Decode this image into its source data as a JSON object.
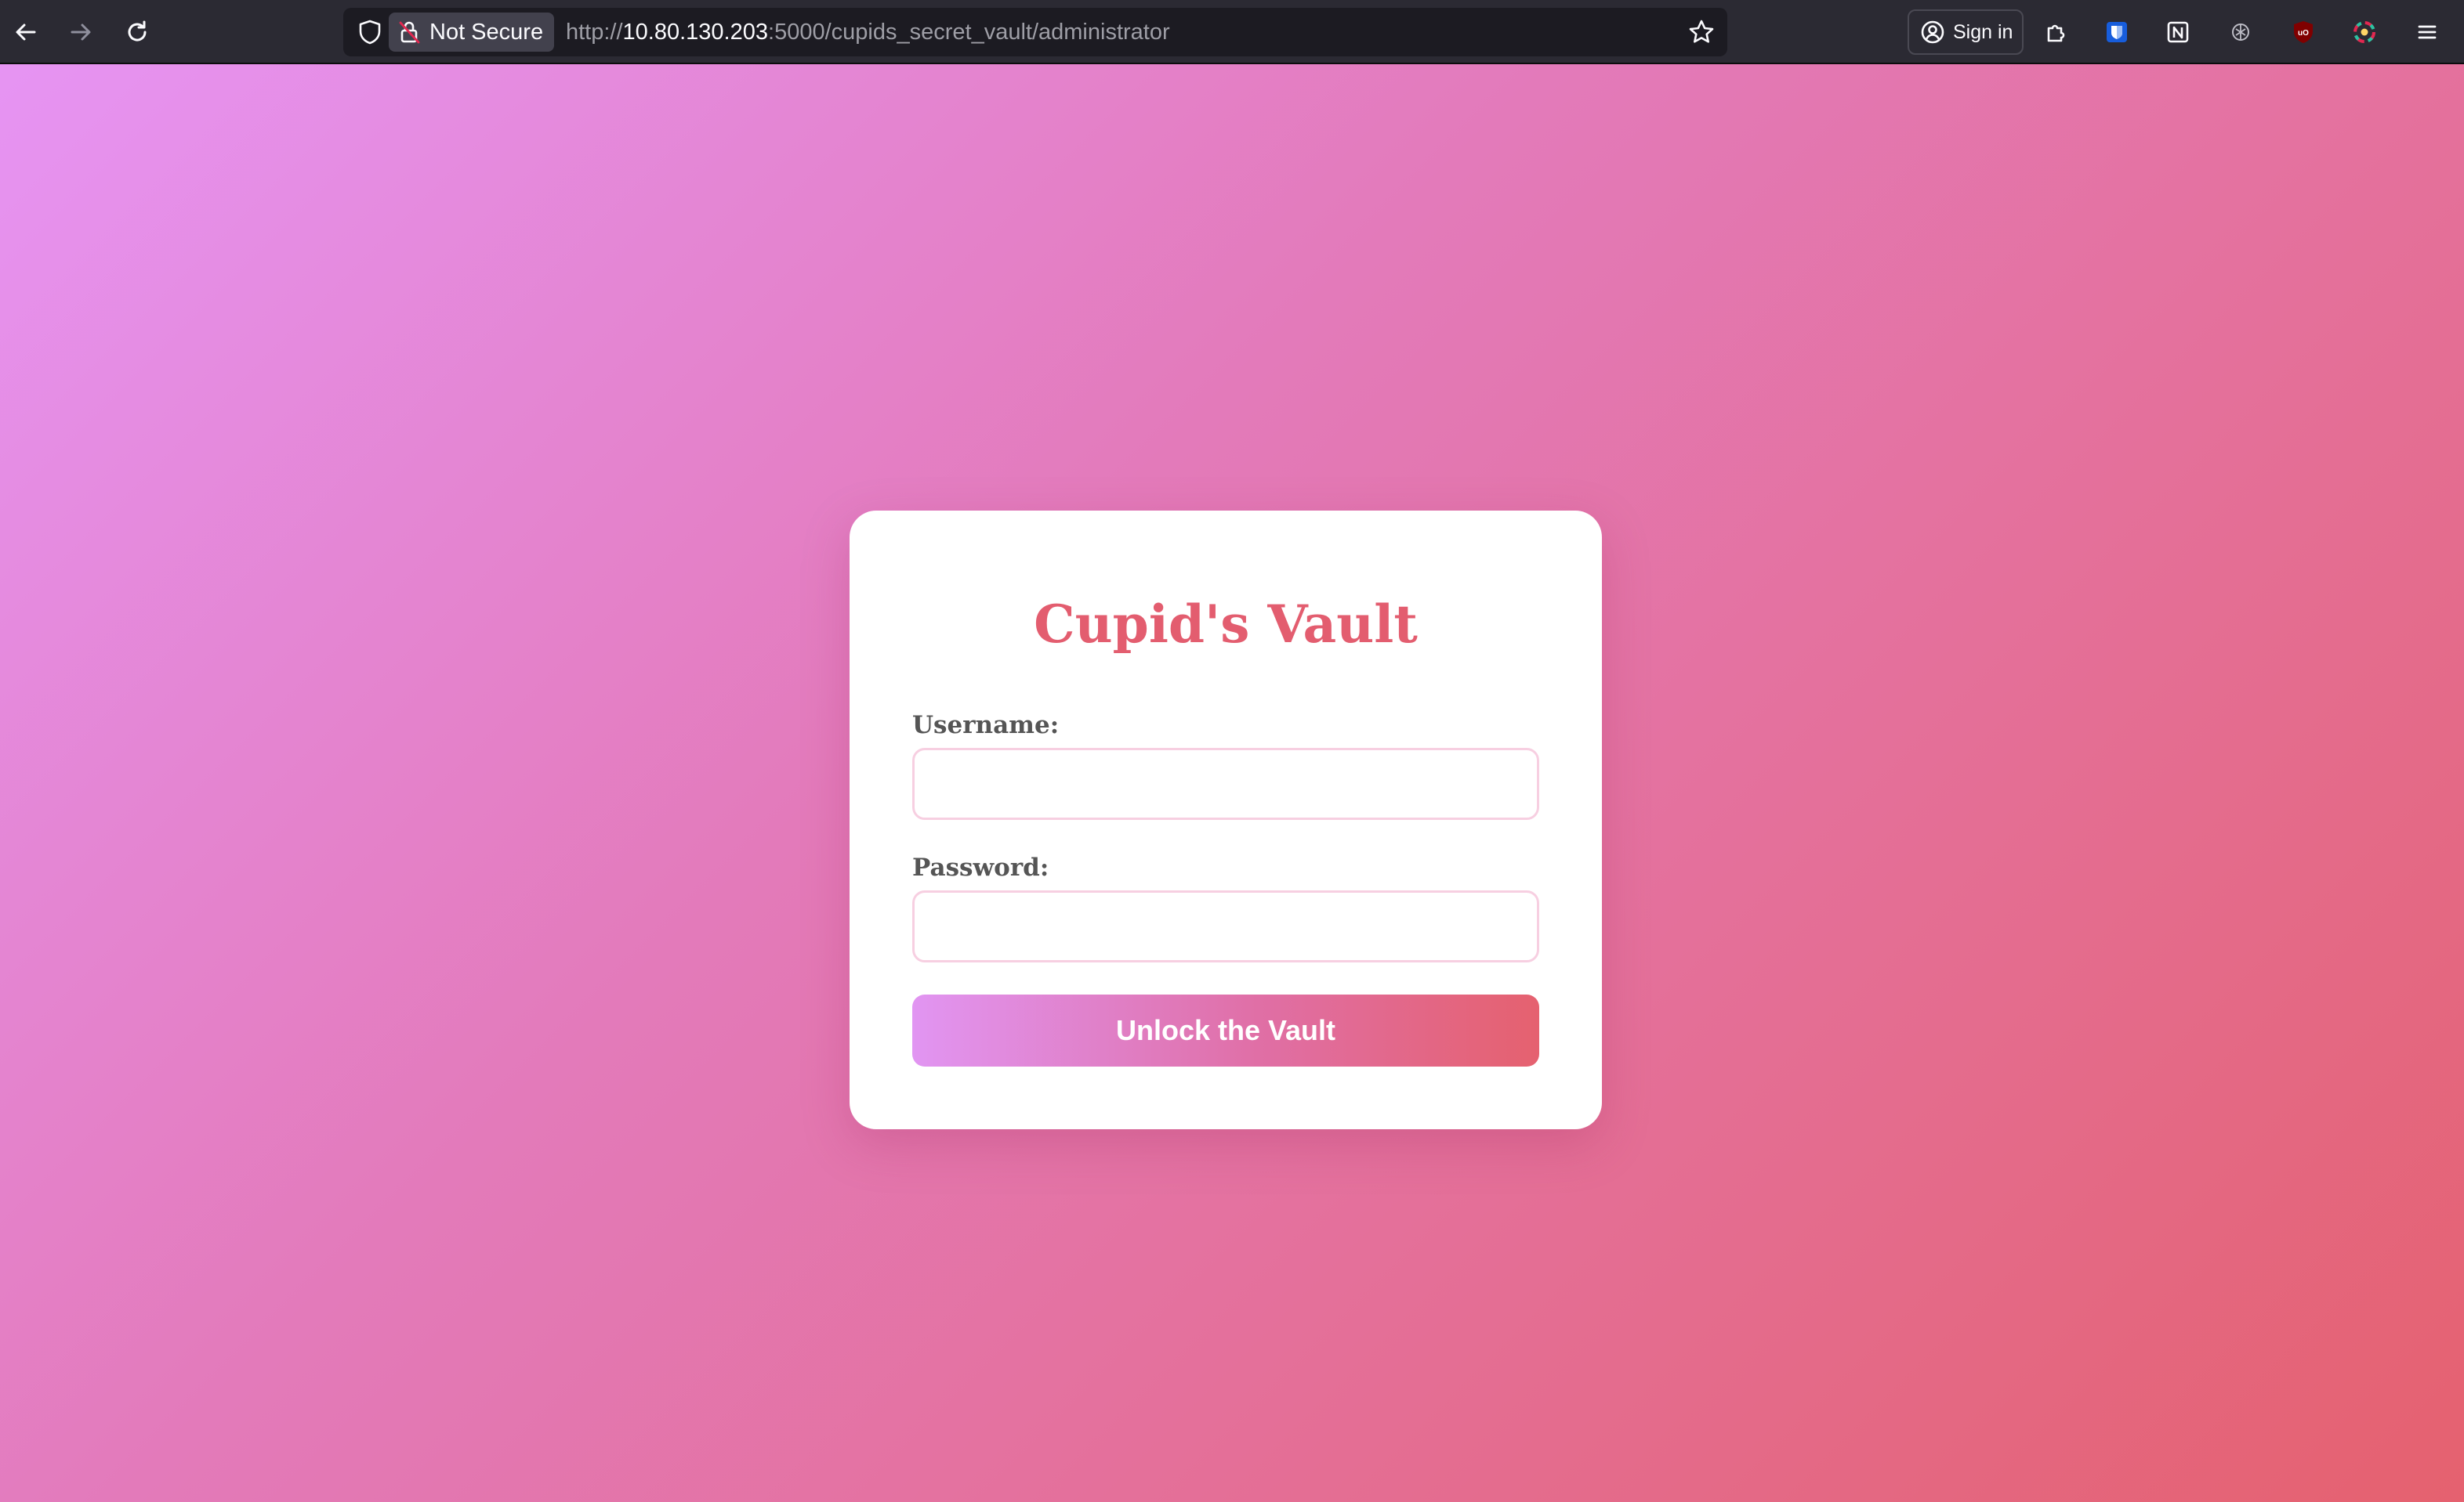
{
  "browser": {
    "security_label": "Not Secure",
    "url_scheme": "http://",
    "url_host": "10.80.130.203",
    "url_rest": ":5000/cupids_secret_vault/administrator",
    "signin_label": "Sign in",
    "toolbar_icons": [
      "back-icon",
      "forward-icon",
      "reload-icon",
      "shield-icon",
      "star-icon",
      "account-icon",
      "extensions-icon",
      "bitwarden-icon",
      "notion-icon",
      "extension-icon",
      "ublock-icon",
      "color-picker-icon",
      "menu-icon"
    ]
  },
  "page": {
    "title": "Cupid's Vault",
    "username_label": "Username:",
    "username_value": "",
    "password_label": "Password:",
    "password_value": "",
    "submit_label": "Unlock the Vault"
  },
  "colors": {
    "gradient_start": "#e694f3",
    "gradient_end": "#e5616f",
    "title": "#e35d6f",
    "input_border": "#f7cfe1"
  }
}
